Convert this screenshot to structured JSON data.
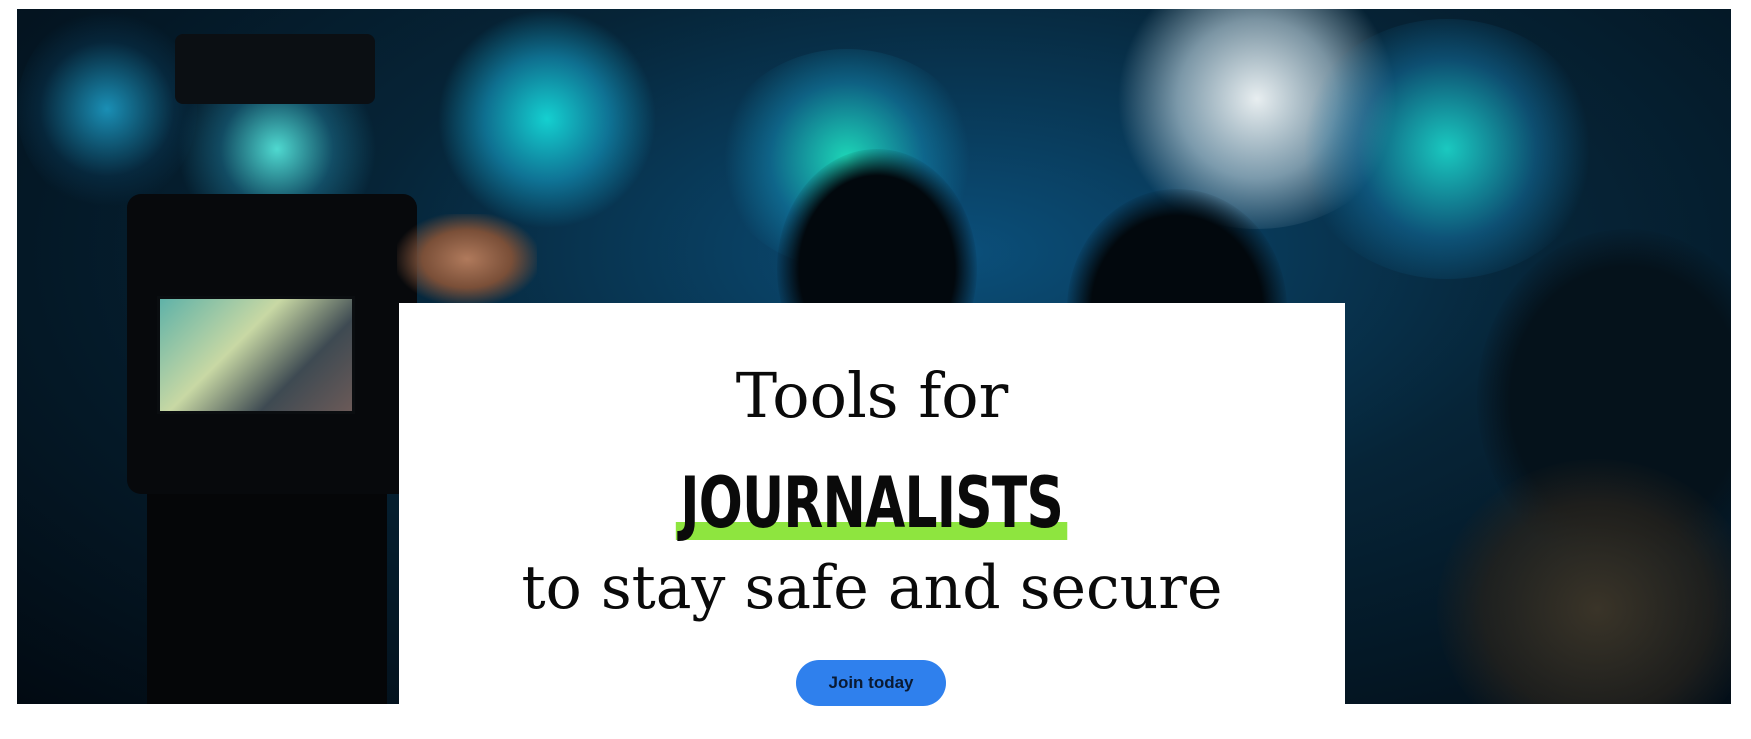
{
  "hero": {
    "image_description_icon": "camera-filming-concert-photo",
    "headline_line1": "Tools for",
    "headline_emphasis": "JOURNALISTS",
    "headline_line3": "to stay safe and secure",
    "cta_label": "Join today",
    "colors": {
      "highlight": "#8ee53f",
      "button": "#2f80ed",
      "card_background": "#ffffff"
    }
  }
}
